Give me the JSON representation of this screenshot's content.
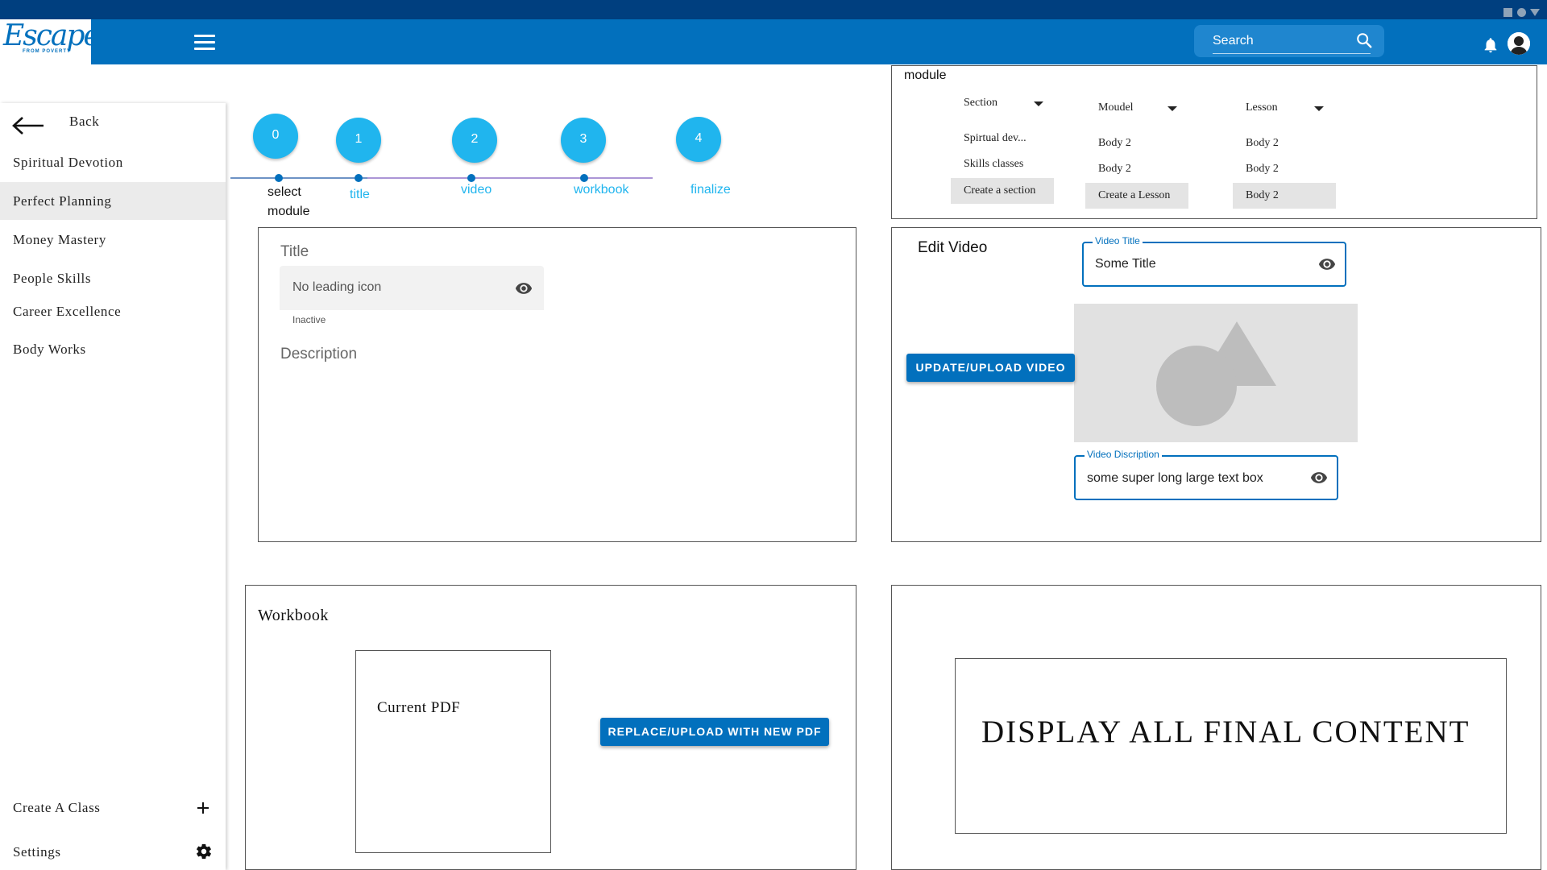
{
  "header": {
    "logo_text": "Escape",
    "logo_sub": "FROM POVERTY",
    "search_placeholder": "Search"
  },
  "sidebar": {
    "back_label": "Back",
    "items": [
      "Spiritual Devotion",
      "Perfect Planning",
      "Money Mastery",
      "People Skills",
      "Career Excellence",
      "Body Works"
    ],
    "selected": "Perfect Planning",
    "create_class_label": "Create A Class",
    "settings_label": "Settings"
  },
  "stepper": {
    "steps": [
      {
        "number": "0",
        "label_line1": "select",
        "label_line2": "module"
      },
      {
        "number": "1",
        "label": "title"
      },
      {
        "number": "2",
        "label": "video"
      },
      {
        "number": "3",
        "label": "workbook"
      },
      {
        "number": "4",
        "label": "finalize"
      }
    ]
  },
  "title_panel": {
    "title_heading": "Title",
    "field_placeholder": "No leading icon",
    "helper_text": "Inactive",
    "description_heading": "Description"
  },
  "module_panel": {
    "heading": "module",
    "section": {
      "label": "Section",
      "items": [
        "Spirtual dev...",
        "Skills classes"
      ],
      "create_label": "Create a section"
    },
    "moudel": {
      "label": "Moudel",
      "items": [
        "Body 2",
        "Body 2"
      ],
      "create_label": "Create a Lesson"
    },
    "lesson": {
      "label": "Lesson",
      "items": [
        "Body 2",
        "Body 2",
        "Body 2"
      ]
    }
  },
  "video_panel": {
    "heading": "Edit Video",
    "video_title_label": "Video Title",
    "video_title_value": "Some Title",
    "upload_button": "UPDATE/UPLOAD VIDEO",
    "video_description_label": "Video Discription",
    "video_description_value": "some super long large text box"
  },
  "workbook_panel": {
    "heading": "Workbook",
    "pdf_label": "Current PDF",
    "replace_button": "REPLACE/UPLOAD WITH NEW PDF"
  },
  "final_panel": {
    "text": "DISPLAY ALL FINAL CONTENT"
  },
  "colors": {
    "top_bar": "#003f7f",
    "app_bar": "#0270bd",
    "step_circle": "#20b5ee",
    "selected_sidebar": "#ebebeb"
  }
}
